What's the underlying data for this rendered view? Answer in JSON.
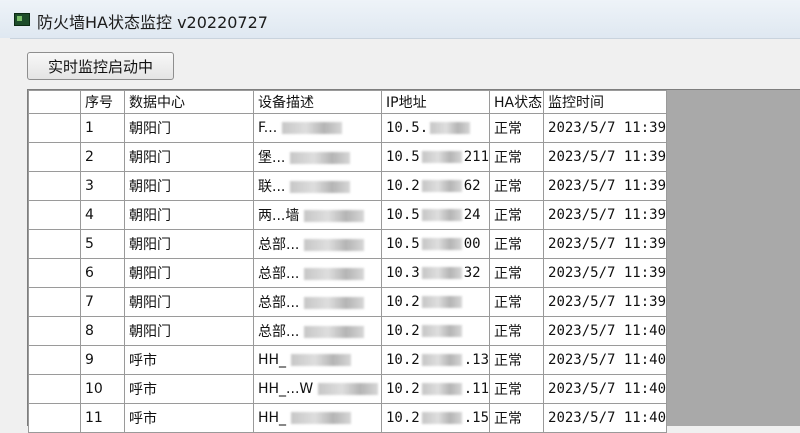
{
  "window": {
    "title": "防火墙HA状态监控 v20220727"
  },
  "toolbar": {
    "monitor_button": "实时监控启动中"
  },
  "table": {
    "headers": [
      "序号",
      "数据中心",
      "设备描述",
      "IP地址",
      "HA状态",
      "监控时间"
    ],
    "rows": [
      {
        "no": "1",
        "dc": "朝阳门",
        "desc": "F...",
        "ip": "10.5.",
        "ip2": "",
        "status": "正常",
        "time": "2023/5/7 11:39"
      },
      {
        "no": "2",
        "dc": "朝阳门",
        "desc": "堡...",
        "ip": "10.5",
        "ip2": "211",
        "status": "正常",
        "time": "2023/5/7 11:39"
      },
      {
        "no": "3",
        "dc": "朝阳门",
        "desc": "联...",
        "ip": "10.2",
        "ip2": "62",
        "status": "正常",
        "time": "2023/5/7 11:39"
      },
      {
        "no": "4",
        "dc": "朝阳门",
        "desc": "两...墙",
        "ip": "10.5",
        "ip2": "24",
        "status": "正常",
        "time": "2023/5/7 11:39"
      },
      {
        "no": "5",
        "dc": "朝阳门",
        "desc": "总部...",
        "ip": "10.5",
        "ip2": "00",
        "status": "正常",
        "time": "2023/5/7 11:39"
      },
      {
        "no": "6",
        "dc": "朝阳门",
        "desc": "总部...",
        "ip": "10.3",
        "ip2": "32",
        "status": "正常",
        "time": "2023/5/7 11:39"
      },
      {
        "no": "7",
        "dc": "朝阳门",
        "desc": "总部...",
        "ip": "10.2",
        "ip2": "",
        "status": "正常",
        "time": "2023/5/7 11:39"
      },
      {
        "no": "8",
        "dc": "朝阳门",
        "desc": "总部...",
        "ip": "10.2",
        "ip2": "",
        "status": "正常",
        "time": "2023/5/7 11:40"
      },
      {
        "no": "9",
        "dc": "呼市",
        "desc": "HH_",
        "ip": "10.2",
        "ip2": ".13",
        "status": "正常",
        "time": "2023/5/7 11:40"
      },
      {
        "no": "10",
        "dc": "呼市",
        "desc": "HH_...W",
        "ip": "10.2",
        "ip2": ".11",
        "status": "正常",
        "time": "2023/5/7 11:40"
      },
      {
        "no": "11",
        "dc": "呼市",
        "desc": "HH_",
        "ip": "10.2",
        "ip2": ".15",
        "status": "正常",
        "time": "2023/5/7 11:40"
      }
    ]
  }
}
